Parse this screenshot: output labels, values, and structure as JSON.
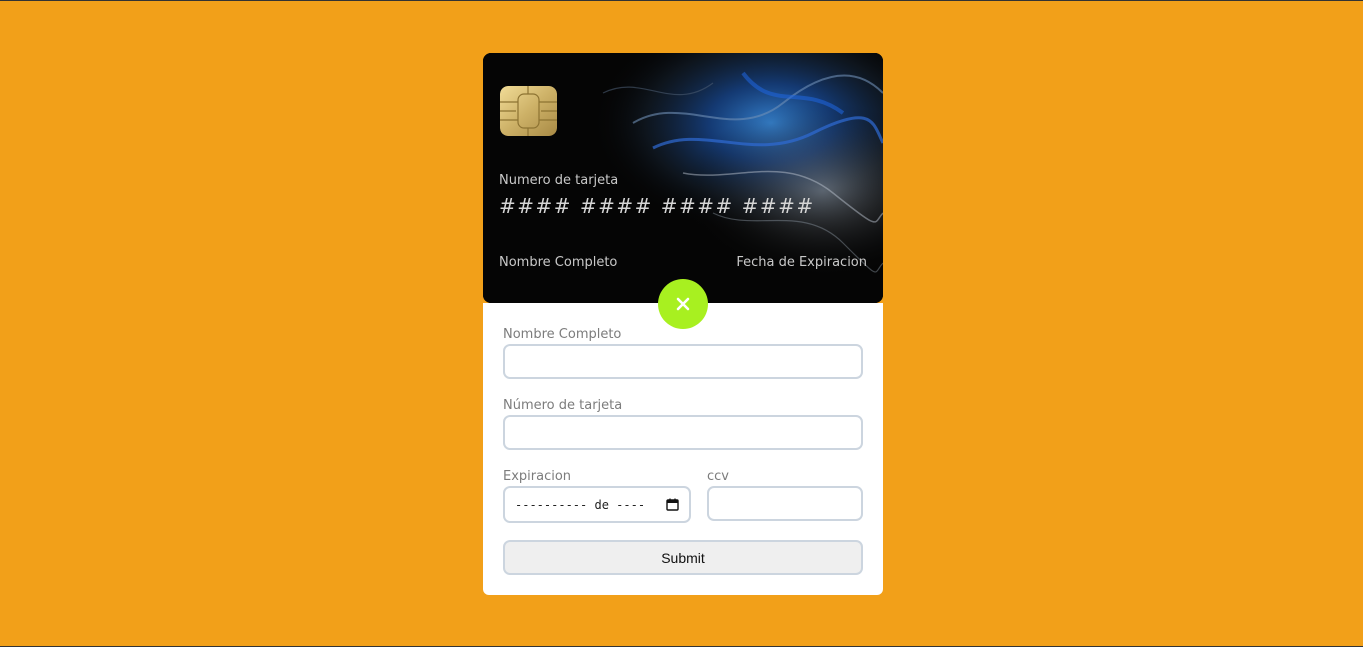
{
  "card": {
    "number_label": "Numero de tarjeta",
    "number_value": "#### #### #### ####",
    "name_label": "Nombre Completo",
    "expiry_label": "Fecha de Expiracion"
  },
  "toggle": {
    "icon": "close-icon",
    "color": "#a8f020"
  },
  "form": {
    "name_label": "Nombre Completo",
    "name_value": "",
    "number_label": "Número de tarjeta",
    "number_value": "",
    "expiry_label": "Expiracion",
    "expiry_value": "---------- de ----",
    "ccv_label": "ccv",
    "ccv_value": "",
    "submit_label": "Submit"
  },
  "colors": {
    "background": "#f2a019",
    "card": "#040404",
    "accent": "#a8f020",
    "input_border": "#ccd5df"
  }
}
